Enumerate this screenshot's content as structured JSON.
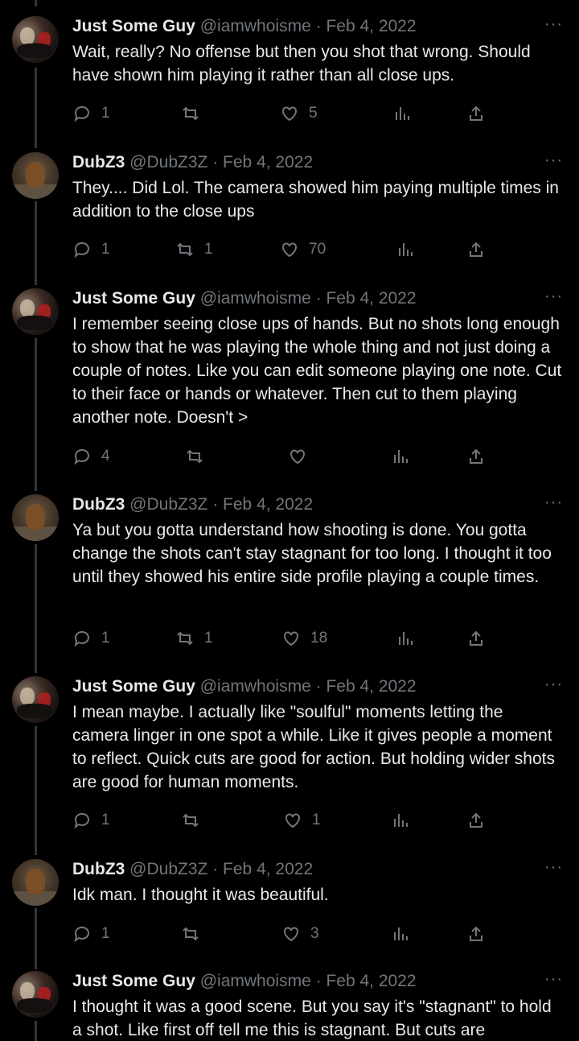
{
  "tweets": [
    {
      "user": "Just Some Guy",
      "handle": "@iamwhoisme",
      "date": "Feb 4, 2022",
      "text": "Wait, really? No offense but then you shot that wrong. Should have shown him playing it rather than all close ups.",
      "replies": "1",
      "retweets": "",
      "likes": "5",
      "avatar": "guy"
    },
    {
      "user": "DubZ3",
      "handle": "@DubZ3Z",
      "date": "Feb 4, 2022",
      "text": "They.... Did Lol. The camera showed him paying multiple times in addition to the close ups",
      "replies": "1",
      "retweets": "1",
      "likes": "70",
      "avatar": "cat"
    },
    {
      "user": "Just Some Guy",
      "handle": "@iamwhoisme",
      "date": "Feb 4, 2022",
      "text": "I remember seeing close ups of hands. But no shots long enough to show that he was playing the whole thing and not just doing a couple of notes. Like you can edit someone playing one note. Cut to their face or hands or whatever. Then cut to them playing another note. Doesn't >",
      "replies": "4",
      "retweets": "",
      "likes": "",
      "avatar": "guy"
    },
    {
      "user": "DubZ3",
      "handle": "@DubZ3Z",
      "date": "Feb 4, 2022",
      "text": "Ya but you gotta understand how shooting is done. You gotta change the shots can't stay stagnant for too long. I thought it too until they showed his entire side profile playing a couple times.",
      "replies": "1",
      "retweets": "1",
      "likes": "18",
      "avatar": "cat"
    },
    {
      "user": "Just Some Guy",
      "handle": "@iamwhoisme",
      "date": "Feb 4, 2022",
      "text": "I mean maybe. I actually like \"soulful\" moments letting the camera linger in one spot a while. Like it gives people a moment to reflect. Quick cuts are good for action. But holding wider shots are good for human moments.",
      "replies": "1",
      "retweets": "",
      "likes": "1",
      "avatar": "guy"
    },
    {
      "user": "DubZ3",
      "handle": "@DubZ3Z",
      "date": "Feb 4, 2022",
      "text": "Idk man. I thought it was beautiful.",
      "replies": "1",
      "retweets": "",
      "likes": "3",
      "avatar": "cat"
    },
    {
      "user": "Just Some Guy",
      "handle": "@iamwhoisme",
      "date": "Feb 4, 2022",
      "text": "I thought it was a good scene. But you say it's \"stagnant\" to hold a shot. Like first off tell me this is stagnant. But cuts are",
      "replies": "",
      "retweets": "",
      "likes": "",
      "avatar": "guy"
    }
  ],
  "separator": "·",
  "more_label": "···",
  "colors": {
    "background": "#000000",
    "text": "#e7e9ea",
    "muted": "#71767b",
    "thread": "#333639"
  },
  "icons": [
    "reply-icon",
    "retweet-icon",
    "like-icon",
    "views-icon",
    "share-icon",
    "more-icon"
  ]
}
